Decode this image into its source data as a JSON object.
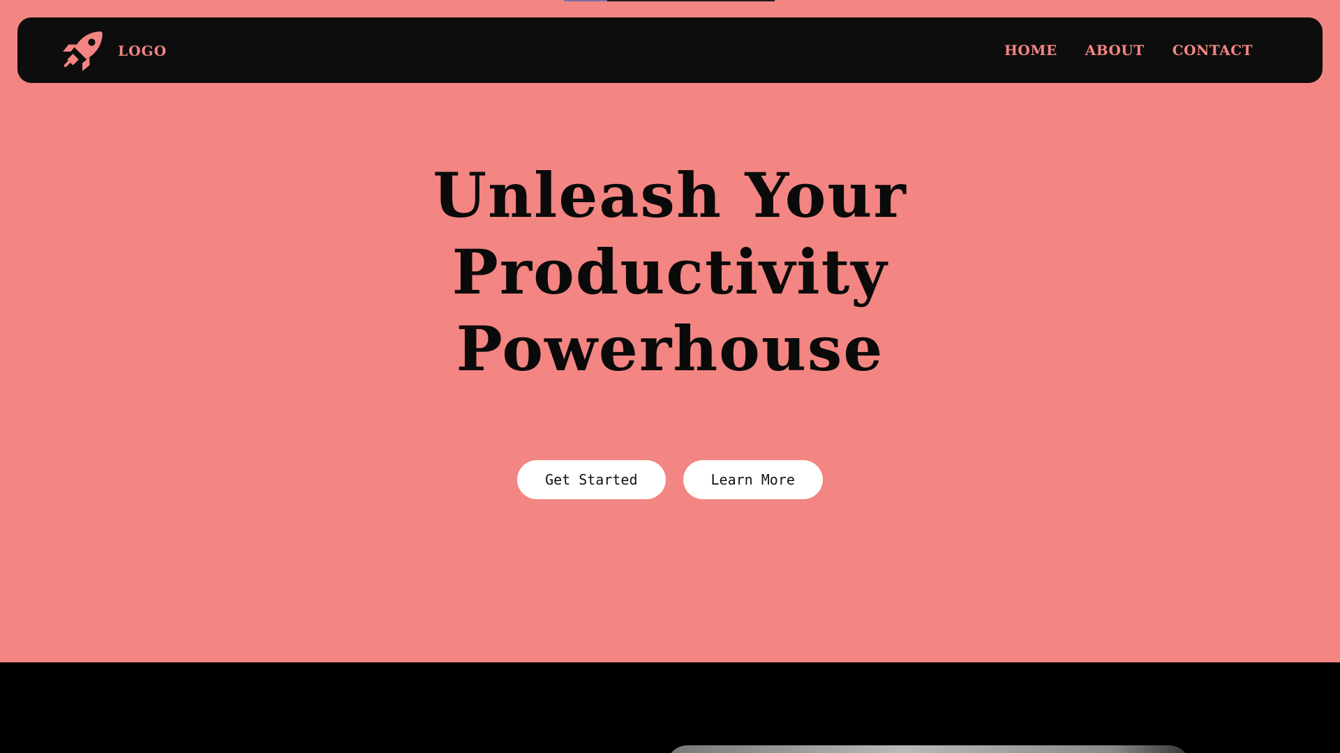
{
  "navbar": {
    "logo_icon": "rocket-icon",
    "logo_text": "LOGO",
    "links": [
      {
        "label": "HOME"
      },
      {
        "label": "ABOUT"
      },
      {
        "label": "CONTACT"
      }
    ]
  },
  "hero": {
    "title": "Unleash Your Productivity Powerhouse",
    "primary_button": "Get Started",
    "secondary_button": "Learn More"
  },
  "colors": {
    "hero_background": "#f38582",
    "navbar_background": "#0d0d0d",
    "accent": "#f38582",
    "title_text": "#0a0a0a",
    "button_background": "#ffffff",
    "section_background": "#000000"
  }
}
